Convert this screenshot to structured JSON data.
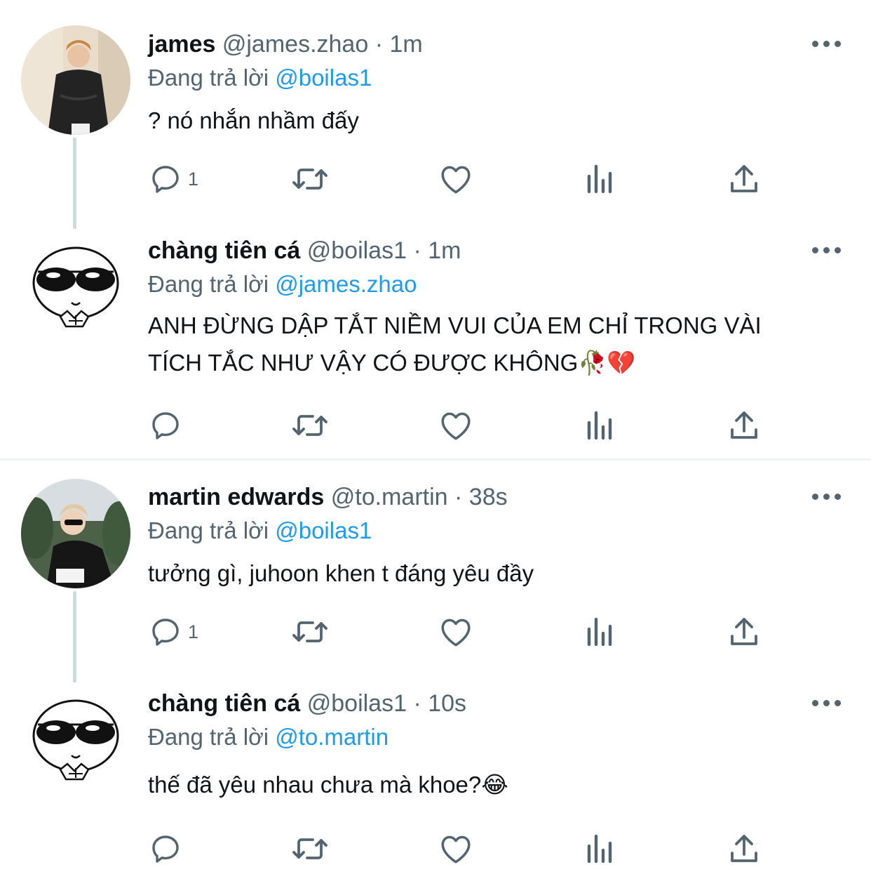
{
  "reply_prefix": "Đang trả lời",
  "dot": "·",
  "tweets": [
    {
      "name": "james",
      "handle": "@james.zhao",
      "time": "1m",
      "reply_to": "@boilas1",
      "text": "? nó nhắn nhầm đấy",
      "emoji": "",
      "reply_count": "1",
      "avatar": "photo-person-dark-jacket"
    },
    {
      "name": "chàng tiên cá",
      "handle": "@boilas1",
      "time": "1m",
      "reply_to": "@james.zhao",
      "text": "ANH ĐỪNG DẬP TẮT NIỀM VUI CỦA EM CHỈ TRONG VÀI TÍCH TẮC NHƯ VẬY CÓ ĐƯỢC KHÔNG🥀💔",
      "emoji": "",
      "reply_count": "",
      "avatar": "cartoon-sunglasses-face"
    },
    {
      "name": "martin edwards",
      "handle": "@to.martin",
      "time": "38s",
      "reply_to": "@boilas1",
      "text": "tưởng gì, juhoon khen t đáng yêu đầy",
      "emoji": "",
      "reply_count": "1",
      "avatar": "photo-person-sunglasses-trees"
    },
    {
      "name": "chàng tiên cá",
      "handle": "@boilas1",
      "time": "10s",
      "reply_to": "@to.martin",
      "text": "thế đã yêu nhau chưa mà khoe?😂",
      "emoji": "",
      "reply_count": "",
      "avatar": "cartoon-sunglasses-face"
    }
  ],
  "icons": [
    "reply-icon",
    "retweet-icon",
    "like-icon",
    "views-icon",
    "share-icon",
    "more-icon"
  ],
  "colors": {
    "text": "#0f1419",
    "muted": "#536471",
    "mention": "#1d9bf0",
    "line": "#cfd9de"
  }
}
